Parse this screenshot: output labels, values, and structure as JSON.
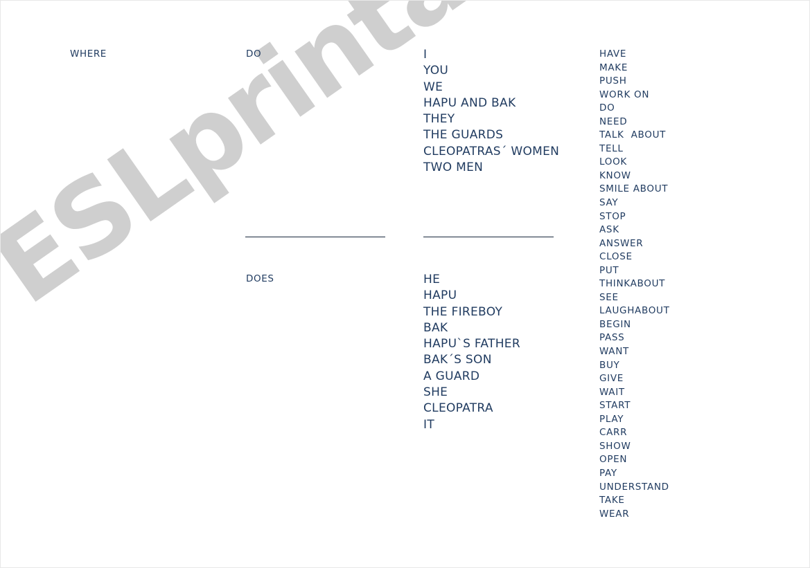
{
  "watermark": {
    "text": "ESLprintables.com",
    "color": "#cfcfcf"
  },
  "colors": {
    "text": "#1f3a5f",
    "rule": "#17253a",
    "page_background": "#ffffff"
  },
  "worksheet": {
    "present_simple_plural": {
      "question_word": "WHERE",
      "auxiliary": "DO",
      "subjects": [
        "I",
        "YOU",
        "WE",
        "HAPU AND BAK",
        "THEY",
        "THE GUARDS",
        "CLEOPATRAS´ WOMEN",
        "TWO MEN"
      ]
    },
    "present_simple_singular": {
      "auxiliary": "DOES",
      "subjects": [
        "HE",
        "HAPU",
        "THE FIREBOY",
        "BAK",
        "HAPU`S FATHER",
        "BAK´S SON",
        "A GUARD",
        "SHE",
        "CLEOPATRA",
        "IT"
      ]
    },
    "verbs": [
      "HAVE",
      "MAKE",
      "PUSH",
      "WORK ON",
      "DO",
      "NEED",
      "TALK  ABOUT",
      "TELL",
      "LOOK",
      "KNOW",
      "SMILE ABOUT",
      "SAY",
      "STOP",
      "ASK",
      "ANSWER",
      "CLOSE",
      "PUT",
      "THINKABOUT",
      "SEE",
      "LAUGHABOUT",
      "BEGIN",
      "PASS",
      "WANT",
      "BUY",
      "GIVE",
      "WAIT",
      "START",
      "PLAY",
      "CARR",
      "SHOW",
      "OPEN",
      "PAY",
      "UNDERSTAND",
      "TAKE",
      "WEAR"
    ]
  }
}
